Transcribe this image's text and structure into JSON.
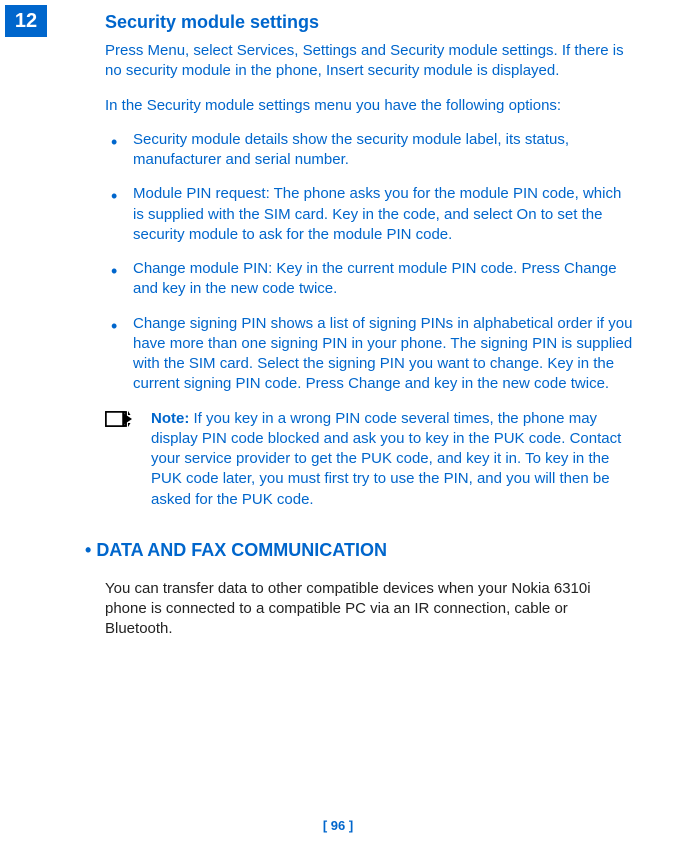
{
  "chapter_number": "12",
  "heading": "Security module settings",
  "intro_paragraph_1": "Press Menu, select Services, Settings and Security module settings. If there is no security module in the phone, Insert security module is displayed.",
  "intro_paragraph_2": "In the Security module settings menu you have the following options:",
  "bullets": [
    "Security module details show the security module label, its status, manufacturer and serial number.",
    "Module PIN request: The phone asks you for the module PIN code, which is supplied with the SIM card. Key in the code, and select On to set the security module to ask for the module PIN code.",
    "Change module PIN: Key in the current module PIN code. Press Change and key in the new code twice.",
    "Change signing PIN shows a list of signing PINs in alphabetical order if you have more than one signing PIN in your phone. The signing PIN is supplied with the SIM card. Select the signing PIN you want to change. Key in the current signing PIN code. Press Change and key in the new code twice."
  ],
  "note_label": "Note:",
  "note_text": " If you key in a wrong PIN code several times, the phone may display PIN code blocked and ask you to key in the PUK code. Contact your service provider to get the PUK code, and key it in. To key in the PUK code later, you must first try to use the PIN, and you will then be asked for the PUK code.",
  "section_heading": "DATA AND FAX COMMUNICATION",
  "section_bullet": "•  ",
  "section_body": "You can transfer data to other compatible devices when your Nokia 6310i phone is connected to a compatible PC via an IR connection, cable or Bluetooth.",
  "footer_page": "[ 96 ]"
}
